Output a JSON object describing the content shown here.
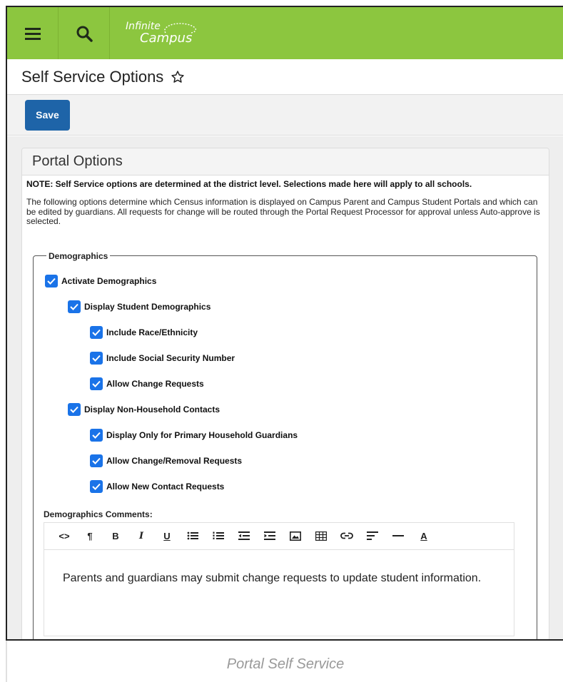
{
  "header": {
    "logo_line1": "Infinite",
    "logo_line2": "Campus",
    "brand_color": "#8cc63f"
  },
  "page": {
    "title": "Self Service Options",
    "save_label": "Save"
  },
  "panel": {
    "title": "Portal Options",
    "note": "NOTE: Self Service options are determined at the district level. Selections made here will apply to all schools.",
    "description": "The following options determine which Census information is displayed on Campus Parent and Campus Student Portals and which can be edited by guardians. All requests for change will be routed through the Portal Request Processor for approval unless Auto-approve is selected."
  },
  "demographics": {
    "legend": "Demographics",
    "options": [
      {
        "label": "Activate Demographics",
        "checked": true
      },
      {
        "label": "Display Student Demographics",
        "checked": true
      },
      {
        "label": "Include Race/Ethnicity",
        "checked": true
      },
      {
        "label": "Include Social Security Number",
        "checked": true
      },
      {
        "label": "Allow Change Requests",
        "checked": true
      },
      {
        "label": "Display Non-Household Contacts",
        "checked": true
      },
      {
        "label": "Display Only for Primary Household Guardians",
        "checked": true
      },
      {
        "label": "Allow Change/Removal Requests",
        "checked": true
      },
      {
        "label": "Allow New Contact Requests",
        "checked": true
      }
    ],
    "comments_label": "Demographics Comments:",
    "comments_text": "Parents and guardians may submit change requests to update student information."
  },
  "editor_tools": [
    "code-icon",
    "paragraph-icon",
    "bold-icon",
    "italic-icon",
    "underline-icon",
    "bulleted-list-icon",
    "numbered-list-icon",
    "outdent-icon",
    "indent-icon",
    "image-icon",
    "table-icon",
    "link-icon",
    "align-icon",
    "horizontal-rule-icon",
    "font-color-icon"
  ],
  "caption": "Portal Self Service"
}
